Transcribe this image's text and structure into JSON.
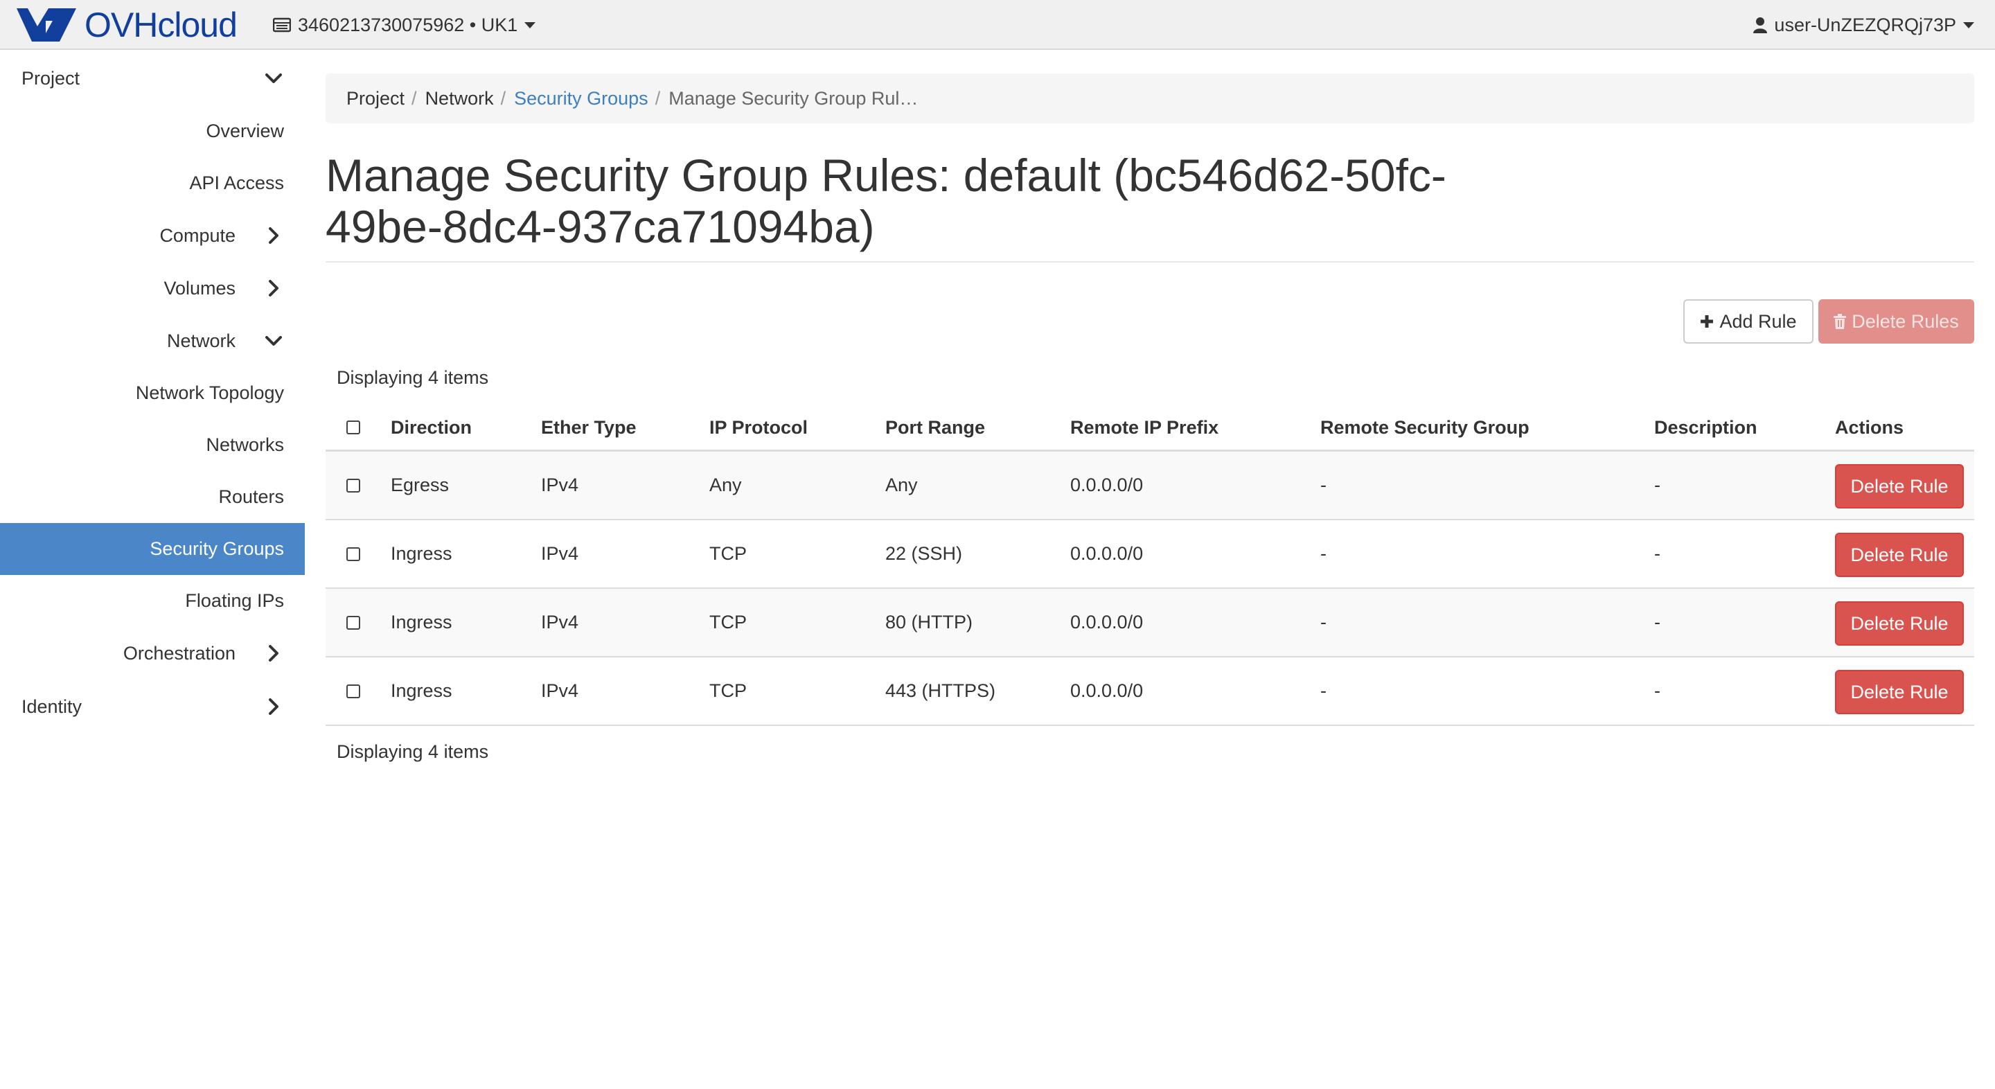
{
  "topbar": {
    "brand": "OVHcloud",
    "project": "3460213730075962 • UK1",
    "user": "user-UnZEZQRQj73P"
  },
  "sidebar": {
    "project_label": "Project",
    "overview": "Overview",
    "api_access": "API Access",
    "compute": "Compute",
    "volumes": "Volumes",
    "network": "Network",
    "network_topology": "Network Topology",
    "networks": "Networks",
    "routers": "Routers",
    "security_groups": "Security Groups",
    "floating_ips": "Floating IPs",
    "orchestration": "Orchestration",
    "identity": "Identity"
  },
  "breadcrumb": {
    "items": [
      "Project",
      "Network",
      "Security Groups",
      "Manage Security Group Rul…"
    ],
    "sep": "/"
  },
  "page": {
    "title_line1": "Manage Security Group Rules: default (bc546d62-50fc-",
    "title_line2": "49be-8dc4-937ca71094ba)",
    "add_rule": "Add Rule",
    "delete_rules": "Delete Rules",
    "count_text": "Displaying 4 items"
  },
  "table": {
    "headers": {
      "direction": "Direction",
      "ether_type": "Ether Type",
      "ip_protocol": "IP Protocol",
      "port_range": "Port Range",
      "remote_ip_prefix": "Remote IP Prefix",
      "remote_security_group": "Remote Security Group",
      "description": "Description",
      "actions": "Actions"
    },
    "rows": [
      {
        "direction": "Egress",
        "ether_type": "IPv4",
        "ip_protocol": "Any",
        "port_range": "Any",
        "remote_ip_prefix": "0.0.0.0/0",
        "remote_security_group": "-",
        "description": "-",
        "action": "Delete Rule"
      },
      {
        "direction": "Ingress",
        "ether_type": "IPv4",
        "ip_protocol": "TCP",
        "port_range": "22 (SSH)",
        "remote_ip_prefix": "0.0.0.0/0",
        "remote_security_group": "-",
        "description": "-",
        "action": "Delete Rule"
      },
      {
        "direction": "Ingress",
        "ether_type": "IPv4",
        "ip_protocol": "TCP",
        "port_range": "80 (HTTP)",
        "remote_ip_prefix": "0.0.0.0/0",
        "remote_security_group": "-",
        "description": "-",
        "action": "Delete Rule"
      },
      {
        "direction": "Ingress",
        "ether_type": "IPv4",
        "ip_protocol": "TCP",
        "port_range": "443 (HTTPS)",
        "remote_ip_prefix": "0.0.0.0/0",
        "remote_security_group": "-",
        "description": "-",
        "action": "Delete Rule"
      }
    ]
  },
  "colors": {
    "brand": "#123f9b",
    "active_nav": "#4a86c8",
    "link": "#3c7fc0",
    "danger": "#d9534f"
  },
  "icons": {
    "logo": "ovh-logo-icon",
    "project": "server-icon",
    "user": "user-icon",
    "add": "plus-icon",
    "delete": "trash-icon",
    "expand": "chevron-down-icon",
    "collapse": "chevron-right-icon"
  }
}
